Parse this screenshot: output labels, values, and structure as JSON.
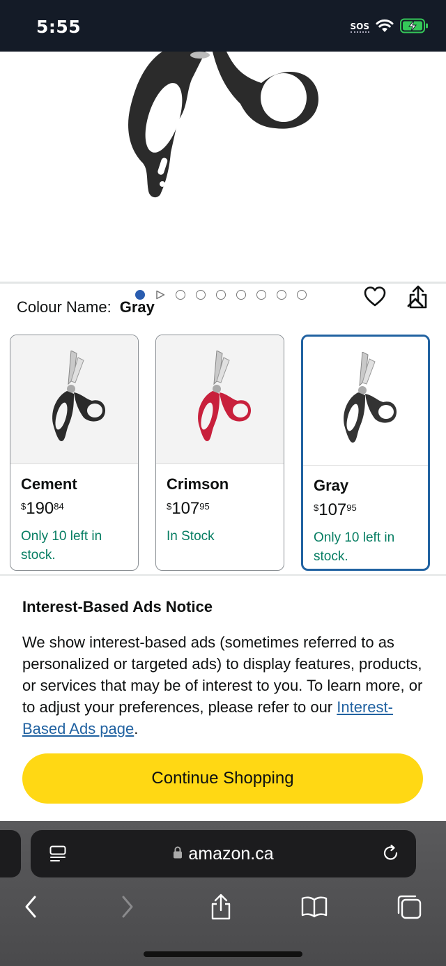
{
  "status_bar": {
    "time": "5:55",
    "sos": "SOS"
  },
  "product": {
    "gallery": {
      "dots": 9,
      "active_index": 0,
      "second_is_video": true
    }
  },
  "colour_selector": {
    "label": "Colour Name:",
    "selected": "Gray",
    "options": [
      {
        "name": "Cement",
        "currency": "$",
        "price_whole": "190",
        "price_cents": "84",
        "stock": "Only 10 left in stock.",
        "handle_color": "#2b2b2b",
        "selected": false
      },
      {
        "name": "Crimson",
        "currency": "$",
        "price_whole": "107",
        "price_cents": "95",
        "stock": "In Stock",
        "handle_color": "#c8203c",
        "selected": false
      },
      {
        "name": "Gray",
        "currency": "$",
        "price_whole": "107",
        "price_cents": "95",
        "stock": "Only 10 left in stock.",
        "handle_color": "#333333",
        "selected": true
      }
    ]
  },
  "ads_notice": {
    "title": "Interest-Based Ads Notice",
    "text": "We show interest-based ads (sometimes referred to as personalized or targeted ads) to display features, products, or services that may be of interest to you. To learn more, or to adjust your preferences, please refer to our ",
    "link_text": "Interest-Based Ads page",
    "text_end": ".",
    "button_label": "Continue Shopping"
  },
  "browser": {
    "url": "amazon.ca"
  },
  "colors": {
    "accent": "#2162a1",
    "cta": "#ffd814",
    "in_stock": "#067d62",
    "status_bar": "#141b27"
  }
}
